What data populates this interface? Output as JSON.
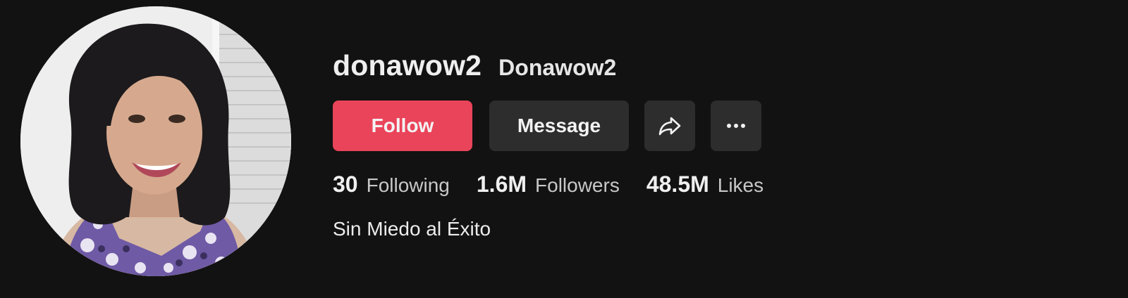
{
  "profile": {
    "username": "donawow2",
    "nickname": "Donawow2",
    "bio": "Sin Miedo al Éxito"
  },
  "actions": {
    "follow_label": "Follow",
    "message_label": "Message",
    "share_icon": "share-arrow-icon",
    "more_icon": "more-dots-icon"
  },
  "stats": {
    "following": {
      "value": "30",
      "label": "Following"
    },
    "followers": {
      "value": "1.6M",
      "label": "Followers"
    },
    "likes": {
      "value": "48.5M",
      "label": "Likes"
    }
  },
  "colors": {
    "background": "#121212",
    "follow_button": "#ea445a",
    "secondary_button": "#2d2d2d"
  }
}
